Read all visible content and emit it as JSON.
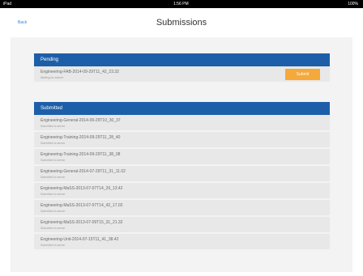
{
  "status_bar": {
    "carrier": "iPad",
    "time": "1:56 PM",
    "battery": "100%"
  },
  "nav": {
    "back_label": "Back",
    "title": "Submissions"
  },
  "pending": {
    "header": "Pending",
    "items": [
      {
        "title": "Engineering-FAB-2014-09-29T11_42_23.32",
        "subtitle": "Waiting for submit",
        "button": "Submit"
      }
    ]
  },
  "submitted": {
    "header": "Submitted",
    "items": [
      {
        "title": "Engineering-General-2014-09-29T10_30_37",
        "subtitle": "Submitted to server"
      },
      {
        "title": "Engineering-Training-2014-09-29T11_28_40",
        "subtitle": "Submitted to server"
      },
      {
        "title": "Engineering-Training-2014-09-29T11_38_08",
        "subtitle": "Submitted to server"
      },
      {
        "title": "Engineering-General-2014-07-29T11_31_11.02",
        "subtitle": "Submitted to server"
      },
      {
        "title": "Engineering-MaSS-2013-07-07T14_29_13.42",
        "subtitle": "Submitted to server"
      },
      {
        "title": "Engineering-MaSS-2013-07-07T14_42_17.02",
        "subtitle": "Submitted to server"
      },
      {
        "title": "Engineering-MaSS-2013-07-09T15_31_21.32",
        "subtitle": "Submitted to server"
      },
      {
        "title": "Engineering-Unit-2014-07-15T11_41_38.42",
        "subtitle": "Submitted to server"
      }
    ]
  },
  "colors": {
    "header_blue": "#1d5ea8",
    "submit_orange": "#f4a93a",
    "link_blue": "#2a86d6"
  }
}
